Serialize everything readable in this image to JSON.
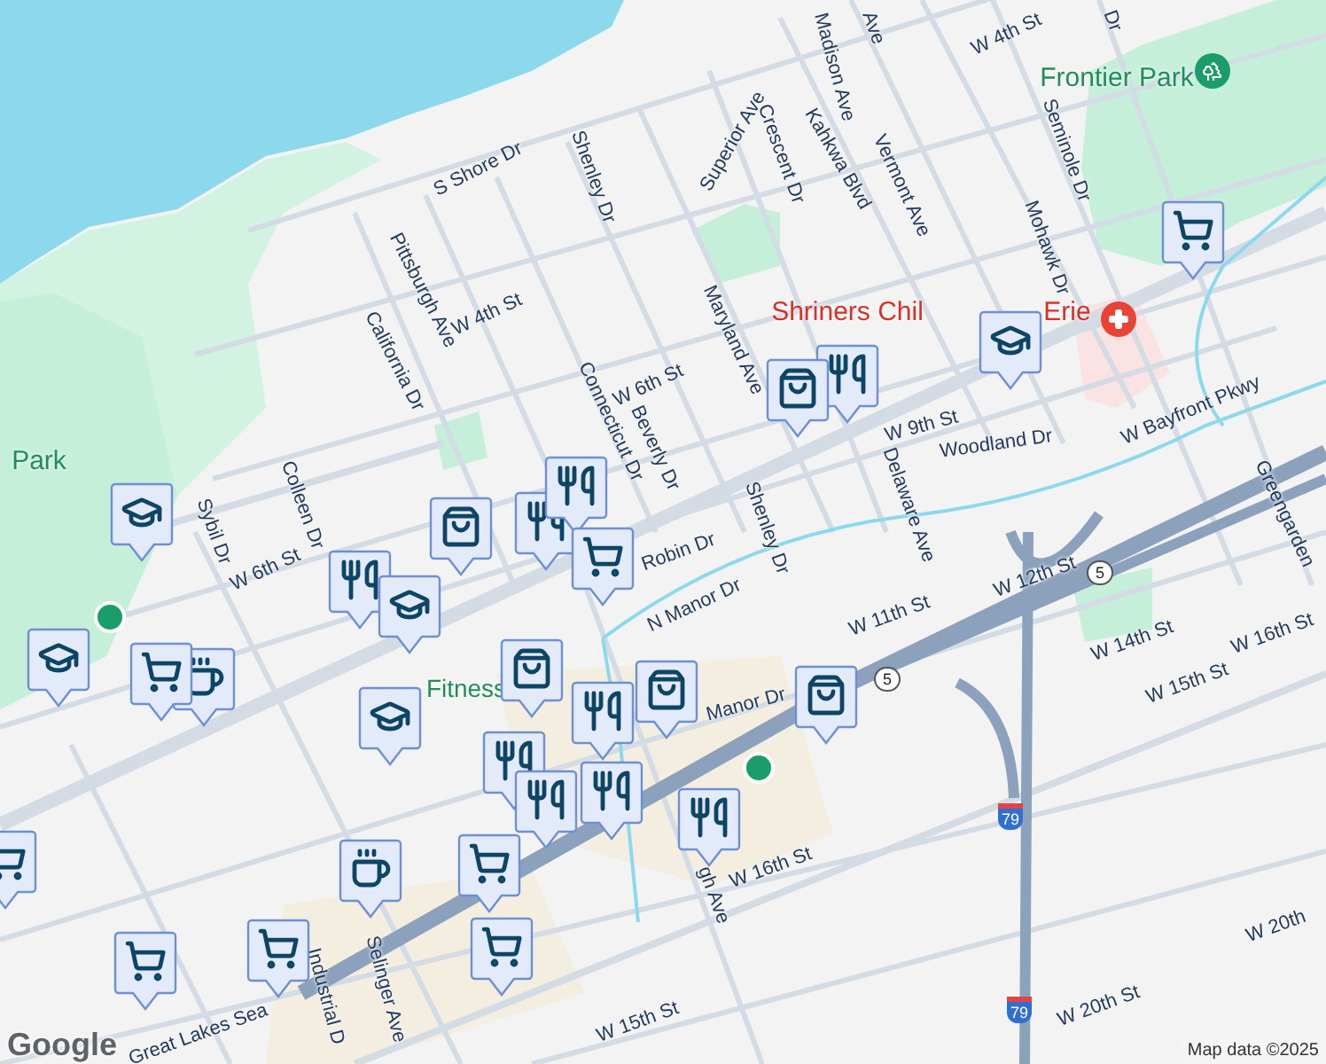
{
  "labels": [
    {
      "text": "Ave",
      "kind": "street"
    },
    {
      "text": "W 4th St",
      "kind": "street"
    },
    {
      "text": "Dr",
      "kind": "street"
    },
    {
      "text": "Madison Ave",
      "kind": "street"
    },
    {
      "text": "Frontier Park",
      "kind": "park"
    },
    {
      "text": "Superior Ave",
      "kind": "street"
    },
    {
      "text": "Crescent Dr",
      "kind": "street"
    },
    {
      "text": "Kahkwa Blvd",
      "kind": "street"
    },
    {
      "text": "Vermont Ave",
      "kind": "street"
    },
    {
      "text": "Seminole Dr",
      "kind": "street"
    },
    {
      "text": "Mohawk Dr",
      "kind": "street"
    },
    {
      "text": "S Shore Dr",
      "kind": "street"
    },
    {
      "text": "Shenley Dr",
      "kind": "street"
    },
    {
      "text": "Pittsburgh Ave",
      "kind": "street"
    },
    {
      "text": "W 4th St",
      "kind": "street"
    },
    {
      "text": "California Dr",
      "kind": "street"
    },
    {
      "text": "W 6th St",
      "kind": "street"
    },
    {
      "text": "Connecticut Dr",
      "kind": "street"
    },
    {
      "text": "Beverly Dr",
      "kind": "street"
    },
    {
      "text": "Maryland Ave",
      "kind": "street"
    },
    {
      "text": "Shriners Chil",
      "kind": "hospital"
    },
    {
      "text": "Erie",
      "kind": "hospital"
    },
    {
      "text": "W 9th St",
      "kind": "street"
    },
    {
      "text": "Woodland Dr",
      "kind": "street"
    },
    {
      "text": "W Bayfront Pkwy",
      "kind": "street"
    },
    {
      "text": "Delaware Ave",
      "kind": "street"
    },
    {
      "text": "Shenley Dr",
      "kind": "street"
    },
    {
      "text": "Robin Dr",
      "kind": "street"
    },
    {
      "text": "Greengarden",
      "kind": "street"
    },
    {
      "text": "W 12th St",
      "kind": "street"
    },
    {
      "text": "N Manor Dr",
      "kind": "street"
    },
    {
      "text": "W 11th St",
      "kind": "street"
    },
    {
      "text": "W 14th St",
      "kind": "street"
    },
    {
      "text": "W 15th St",
      "kind": "street"
    },
    {
      "text": "W 16th St",
      "kind": "street"
    },
    {
      "text": "Manor Dr",
      "kind": "street"
    },
    {
      "text": "Park",
      "kind": "park"
    },
    {
      "text": "Colleen Dr",
      "kind": "street"
    },
    {
      "text": "Sybil Dr",
      "kind": "street"
    },
    {
      "text": "W 6th St",
      "kind": "street"
    },
    {
      "text": "Fitness",
      "kind": "poi"
    },
    {
      "text": "W 16th St",
      "kind": "street"
    },
    {
      "text": "gh Ave",
      "kind": "street"
    },
    {
      "text": "Selinger Ave",
      "kind": "street"
    },
    {
      "text": "Industrial D",
      "kind": "street"
    },
    {
      "text": "Great Lakes Sea",
      "kind": "street"
    },
    {
      "text": "W 15th St",
      "kind": "street"
    },
    {
      "text": "W 20th St",
      "kind": "street"
    },
    {
      "text": "W 20th",
      "kind": "street"
    }
  ],
  "pins": [
    {
      "kind": "school"
    },
    {
      "kind": "school"
    },
    {
      "kind": "cafe"
    },
    {
      "kind": "grocery"
    },
    {
      "kind": "restaurant"
    },
    {
      "kind": "school"
    },
    {
      "kind": "school"
    },
    {
      "kind": "shopping"
    },
    {
      "kind": "restaurant"
    },
    {
      "kind": "restaurant"
    },
    {
      "kind": "grocery"
    },
    {
      "kind": "shopping"
    },
    {
      "kind": "restaurant"
    },
    {
      "kind": "shopping"
    },
    {
      "kind": "restaurant"
    },
    {
      "kind": "restaurant"
    },
    {
      "kind": "restaurant"
    },
    {
      "kind": "restaurant"
    },
    {
      "kind": "shopping"
    },
    {
      "kind": "restaurant"
    },
    {
      "kind": "shopping"
    },
    {
      "kind": "school"
    },
    {
      "kind": "grocery"
    },
    {
      "kind": "cafe"
    },
    {
      "kind": "grocery"
    },
    {
      "kind": "grocery"
    },
    {
      "kind": "grocery"
    },
    {
      "kind": "grocery"
    },
    {
      "kind": "grocery"
    }
  ],
  "shields": [
    {
      "text": "5",
      "kind": "state"
    },
    {
      "text": "5",
      "kind": "state"
    },
    {
      "text": "79",
      "kind": "interstate"
    },
    {
      "text": "79",
      "kind": "interstate"
    }
  ],
  "logo": "Google",
  "attribution": "Map data ©2025"
}
